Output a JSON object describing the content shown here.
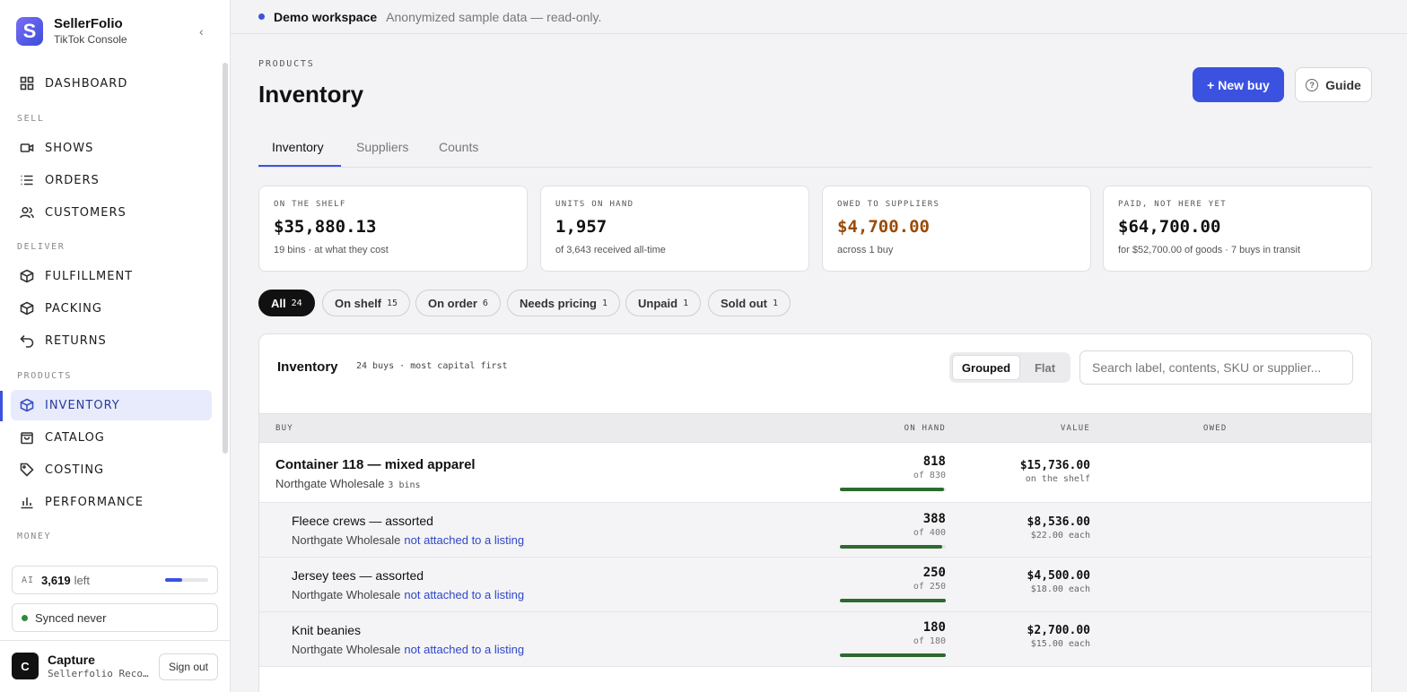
{
  "app": {
    "name": "SellerFolio",
    "subtitle": "TikTok Console",
    "logo_letter": "S"
  },
  "sidebar": {
    "items": [
      {
        "label": "DASHBOARD",
        "icon": "grid-icon"
      },
      {
        "section": "SELL"
      },
      {
        "label": "SHOWS",
        "icon": "video-icon"
      },
      {
        "label": "ORDERS",
        "icon": "list-icon"
      },
      {
        "label": "CUSTOMERS",
        "icon": "users-icon"
      },
      {
        "section": "DELIVER"
      },
      {
        "label": "FULFILLMENT",
        "icon": "box-icon"
      },
      {
        "label": "PACKING",
        "icon": "box-icon"
      },
      {
        "label": "RETURNS",
        "icon": "return-icon"
      },
      {
        "section": "PRODUCTS"
      },
      {
        "label": "INVENTORY",
        "icon": "box-icon",
        "active": true
      },
      {
        "label": "CATALOG",
        "icon": "bag-icon"
      },
      {
        "label": "COSTING",
        "icon": "tag-icon"
      },
      {
        "label": "PERFORMANCE",
        "icon": "bar-chart-icon"
      },
      {
        "section": "MONEY"
      }
    ],
    "ai": {
      "tag": "AI",
      "count": "3,619",
      "suffix": "left",
      "fraction": 0.4
    },
    "sync": {
      "label": "Synced never",
      "color": "#2f8a3c"
    },
    "user": {
      "initial": "C",
      "name": "Capture",
      "org": "Sellerfolio Recordings",
      "signout": "Sign out"
    }
  },
  "banner": {
    "title": "Demo workspace",
    "note": "Anonymized sample data — read-only."
  },
  "header": {
    "crumb": "PRODUCTS",
    "title": "Inventory",
    "new_buy": "+ New buy",
    "guide": "Guide"
  },
  "tabs": [
    "Inventory",
    "Suppliers",
    "Counts"
  ],
  "stats": [
    {
      "label": "ON THE SHELF",
      "value": "$35,880.13",
      "sub": "19 bins · at what they cost"
    },
    {
      "label": "UNITS ON HAND",
      "value": "1,957",
      "sub": "of 3,643 received all-time"
    },
    {
      "label": "OWED TO SUPPLIERS",
      "value": "$4,700.00",
      "sub": "across 1 buy"
    },
    {
      "label": "PAID, NOT HERE YET",
      "value": "$64,700.00",
      "sub": "for $52,700.00 of goods · 7 buys in transit"
    }
  ],
  "filters": [
    {
      "label": "All",
      "count": "24",
      "active": true
    },
    {
      "label": "On shelf",
      "count": "15"
    },
    {
      "label": "On order",
      "count": "6"
    },
    {
      "label": "Needs pricing",
      "count": "1"
    },
    {
      "label": "Unpaid",
      "count": "1"
    },
    {
      "label": "Sold out",
      "count": "1"
    }
  ],
  "panel": {
    "title": "Inventory",
    "subtitle": "24 buys · most capital first",
    "view_grouped": "Grouped",
    "view_flat": "Flat",
    "search_placeholder": "Search label, contents, SKU or supplier..."
  },
  "table": {
    "headers": {
      "buy": "BUY",
      "on_hand": "ON HAND",
      "value": "VALUE",
      "owed": "OWED"
    },
    "rows": [
      {
        "kind": "group",
        "name": "Container 118 — mixed apparel",
        "supplier": "Northgate Wholesale",
        "bins": "3 bins",
        "on_hand": "818",
        "of": "of 830",
        "fill": 0.986,
        "value": "$15,736.00",
        "value_sub": "on the shelf"
      },
      {
        "kind": "child",
        "name": "Fleece crews — assorted",
        "supplier": "Northgate Wholesale",
        "link": "not attached to a listing",
        "on_hand": "388",
        "of": "of 400",
        "fill": 0.97,
        "value": "$8,536.00",
        "value_sub": "$22.00 each"
      },
      {
        "kind": "child",
        "name": "Jersey tees — assorted",
        "supplier": "Northgate Wholesale",
        "link": "not attached to a listing",
        "on_hand": "250",
        "of": "of 250",
        "fill": 1.0,
        "value": "$4,500.00",
        "value_sub": "$18.00 each"
      },
      {
        "kind": "child",
        "name": "Knit beanies",
        "supplier": "Northgate Wholesale",
        "link": "not attached to a listing",
        "on_hand": "180",
        "of": "of 180",
        "fill": 1.0,
        "value": "$2,700.00",
        "value_sub": "$15.00 each"
      }
    ]
  }
}
